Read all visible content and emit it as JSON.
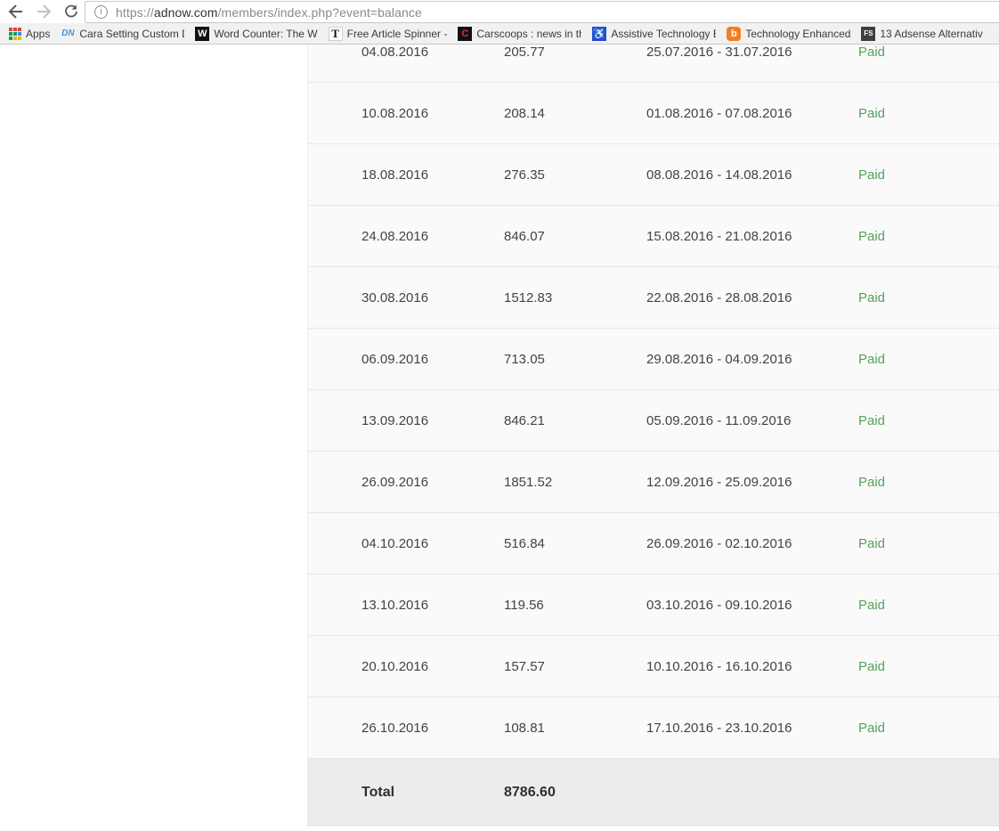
{
  "browser": {
    "url": {
      "scheme": "https://",
      "domain": "adnow.com",
      "path": "/members/index.php?event=balance"
    },
    "page_info_glyph": "i",
    "apps_label": "Apps",
    "apps_grid_colors": [
      "#db4437",
      "#db4437",
      "#db4437",
      "#0f9d58",
      "#0f9d58",
      "#4285f4",
      "#0f9d58",
      "#f4b400",
      "#f4b400"
    ],
    "bookmarks": [
      {
        "label": "Cara Setting Custom D",
        "icon": {
          "name": "dn-favicon",
          "text": "DN",
          "bg": "none",
          "color": "#4596e0",
          "style": "italic",
          "fs": "10px"
        }
      },
      {
        "label": "Word Counter: The W",
        "icon": {
          "name": "word-counter-favicon",
          "text": "W",
          "bg": "#111111",
          "color": "#ffffff"
        }
      },
      {
        "label": "Free Article Spinner - ",
        "icon": {
          "name": "article-spinner-favicon",
          "text": "T",
          "bg": "#ffffff",
          "color": "#111111",
          "serif": true,
          "border": "#d0d0d0",
          "fs": "13px"
        }
      },
      {
        "label": "Carscoops : news in th",
        "icon": {
          "name": "carscoops-favicon",
          "text": "C",
          "bg": "#111111",
          "color": "#e03131"
        }
      },
      {
        "label": "Assistive Technology E",
        "icon": {
          "name": "assistive-technology-favicon",
          "text": "♿",
          "bg": "#2b49c8",
          "color": "#ffffff",
          "fs": "12px"
        }
      },
      {
        "label": "Technology Enhanced",
        "icon": {
          "name": "blogger-favicon",
          "text": "b",
          "bg": "#f57d20",
          "color": "#ffffff",
          "radius": "4px"
        }
      },
      {
        "label": "13 Adsense Alternativ",
        "icon": {
          "name": "fs-favicon",
          "text": "FS",
          "bg": "#3f3f3f",
          "color": "#ffffff",
          "fs": "8px"
        }
      }
    ]
  },
  "table": {
    "rows": [
      {
        "date": "04.08.2016",
        "amount": "205.77",
        "period": "25.07.2016 - 31.07.2016",
        "status": "Paid"
      },
      {
        "date": "10.08.2016",
        "amount": "208.14",
        "period": "01.08.2016 - 07.08.2016",
        "status": "Paid"
      },
      {
        "date": "18.08.2016",
        "amount": "276.35",
        "period": "08.08.2016 - 14.08.2016",
        "status": "Paid"
      },
      {
        "date": "24.08.2016",
        "amount": "846.07",
        "period": "15.08.2016 - 21.08.2016",
        "status": "Paid"
      },
      {
        "date": "30.08.2016",
        "amount": "1512.83",
        "period": "22.08.2016 - 28.08.2016",
        "status": "Paid"
      },
      {
        "date": "06.09.2016",
        "amount": "713.05",
        "period": "29.08.2016 - 04.09.2016",
        "status": "Paid"
      },
      {
        "date": "13.09.2016",
        "amount": "846.21",
        "period": "05.09.2016 - 11.09.2016",
        "status": "Paid"
      },
      {
        "date": "26.09.2016",
        "amount": "1851.52",
        "period": "12.09.2016 - 25.09.2016",
        "status": "Paid"
      },
      {
        "date": "04.10.2016",
        "amount": "516.84",
        "period": "26.09.2016 - 02.10.2016",
        "status": "Paid"
      },
      {
        "date": "13.10.2016",
        "amount": "119.56",
        "period": "03.10.2016 - 09.10.2016",
        "status": "Paid"
      },
      {
        "date": "20.10.2016",
        "amount": "157.57",
        "period": "10.10.2016 - 16.10.2016",
        "status": "Paid"
      },
      {
        "date": "26.10.2016",
        "amount": "108.81",
        "period": "17.10.2016 - 23.10.2016",
        "status": "Paid"
      }
    ],
    "total_label": "Total",
    "total_amount": "8786.60"
  },
  "colors": {
    "paid_green": "#55a05a",
    "row_background": "#fafafa",
    "total_background": "#ececec",
    "bookmarks_bar": "#f1f1f1"
  }
}
